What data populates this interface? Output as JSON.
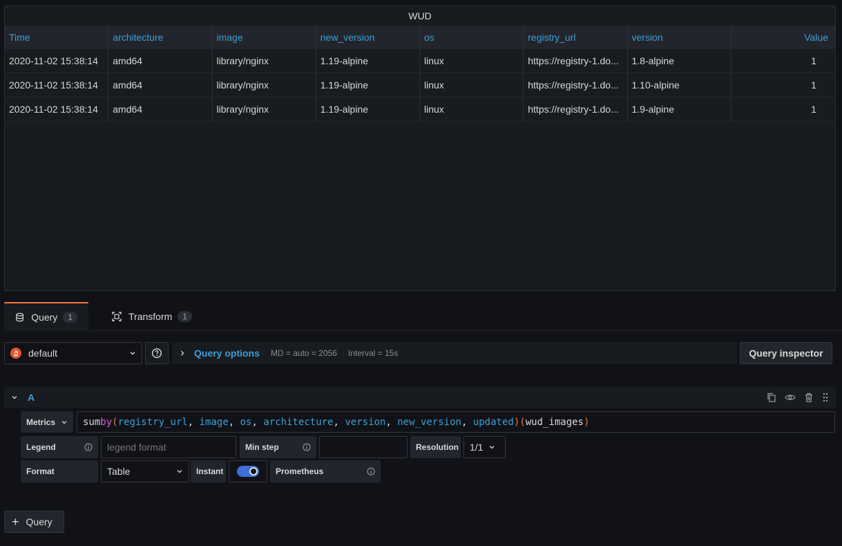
{
  "panel": {
    "title": "WUD",
    "columns": [
      "Time",
      "architecture",
      "image",
      "new_version",
      "os",
      "registry_url",
      "version",
      "Value"
    ],
    "rows": [
      [
        "2020-11-02 15:38:14",
        "amd64",
        "library/nginx",
        "1.19-alpine",
        "linux",
        "https://registry-1.do...",
        "1.8-alpine",
        "1"
      ],
      [
        "2020-11-02 15:38:14",
        "amd64",
        "library/nginx",
        "1.19-alpine",
        "linux",
        "https://registry-1.do...",
        "1.10-alpine",
        "1"
      ],
      [
        "2020-11-02 15:38:14",
        "amd64",
        "library/nginx",
        "1.19-alpine",
        "linux",
        "https://registry-1.do...",
        "1.9-alpine",
        "1"
      ]
    ]
  },
  "tabs": [
    {
      "label": "Query",
      "count": "1",
      "icon": "database-icon"
    },
    {
      "label": "Transform",
      "count": "1",
      "icon": "transform-icon"
    }
  ],
  "datasource": {
    "name": "default",
    "icon": "prometheus-icon"
  },
  "query_options": {
    "label": "Query options",
    "md": "MD = auto = 2056",
    "interval": "Interval = 15s"
  },
  "query_inspector": "Query inspector",
  "query": {
    "ref_id": "A",
    "metrics_label": "Metrics",
    "expr": {
      "fn": "sum",
      "kw": "by",
      "labels": [
        "registry_url",
        "image",
        "os",
        "architecture",
        "version",
        "new_version",
        "updated"
      ],
      "metric": "wud_images"
    },
    "legend_label": "Legend",
    "legend_placeholder": "legend format",
    "min_step_label": "Min step",
    "min_step_value": "",
    "resolution_label": "Resolution",
    "resolution_value": "1/1",
    "format_label": "Format",
    "format_value": "Table",
    "instant_label": "Instant",
    "instant_on": true,
    "prometheus_label": "Prometheus"
  },
  "add_query": "Query",
  "colors": {
    "accent": "#3d9fd8",
    "tab_active": "#f5793b",
    "toggle_on": "#3d71d9",
    "keyword": "#d45fd6"
  }
}
